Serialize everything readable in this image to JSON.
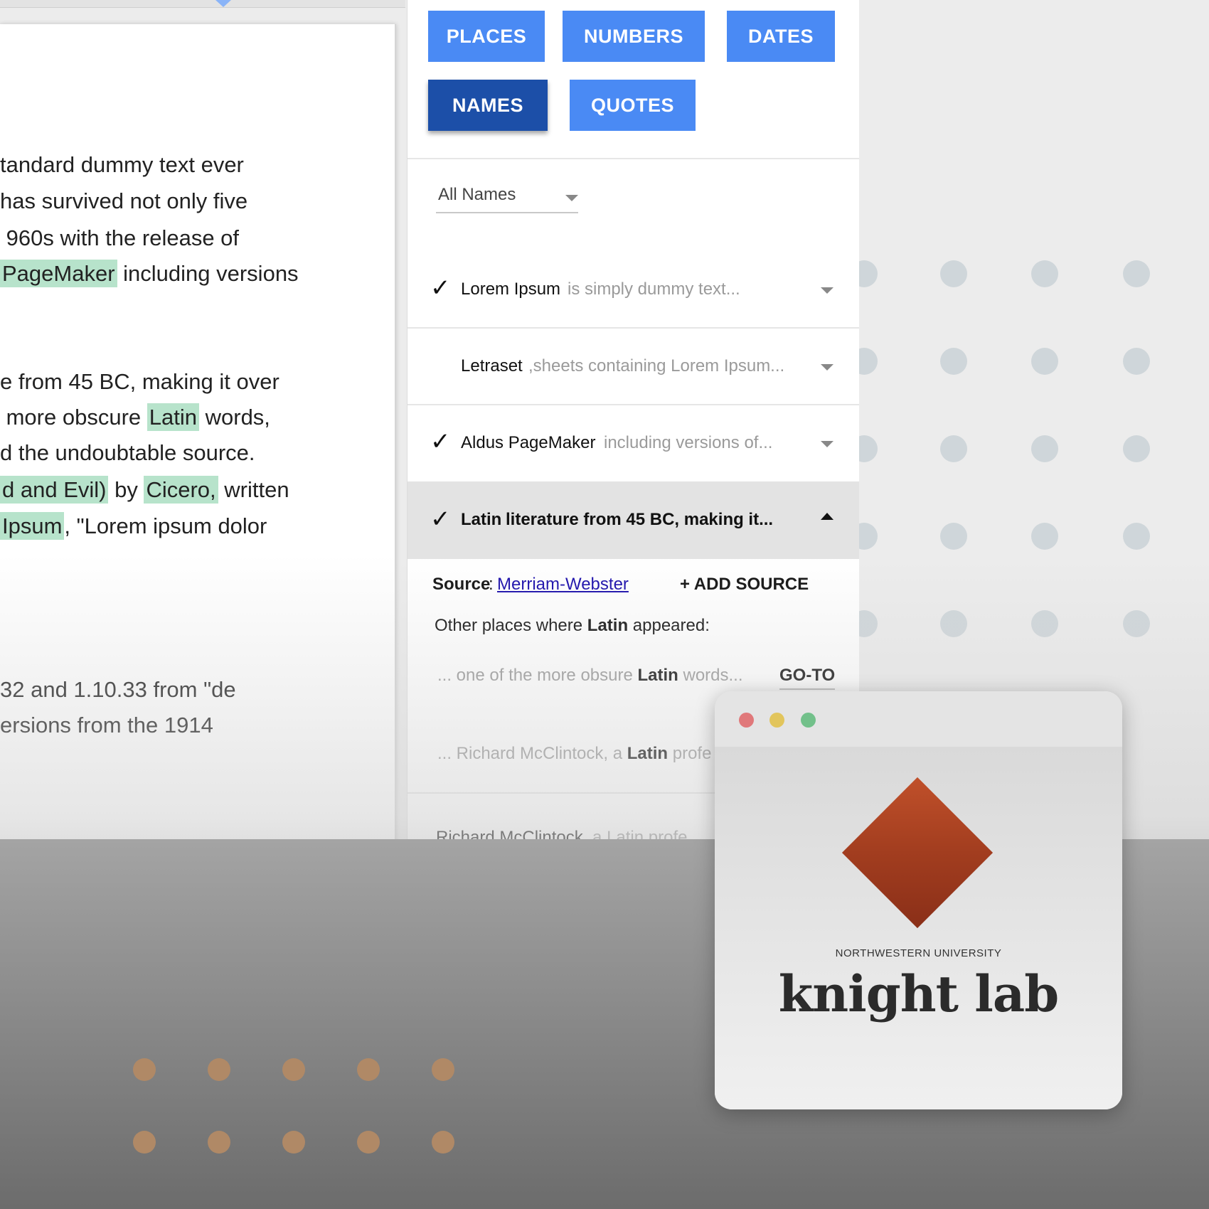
{
  "doc": {
    "lines": [
      {
        "t": "tandard dummy text ever"
      },
      {
        "t": "has survived not only five"
      },
      {
        "t": " 960s with the release of"
      },
      {
        "h": "PageMaker",
        "t": " including versions"
      },
      {
        "t": "e from 45 BC, making it over"
      },
      {
        "t": " more obscure ",
        "h": "Latin",
        "t2": " words,"
      },
      {
        "t": "d the undoubtable source."
      },
      {
        "h": "d and Evil)",
        "t": " by ",
        "h2": "Cicero,",
        "t2": " written"
      },
      {
        "h": "Ipsum",
        "t": ", \"Lorem ipsum dolor"
      },
      {
        "t": "32 and 1.10.33 from \"de"
      },
      {
        "t": "ersions from the 1914"
      }
    ]
  },
  "categories": [
    "PLACES",
    "NUMBERS",
    "DATES",
    "NAMES",
    "QUOTES"
  ],
  "active_category": "NAMES",
  "filter": {
    "label": "All Names"
  },
  "entries": [
    {
      "checked": true,
      "name": "Lorem Ipsum",
      "snippet": "is simply dummy text...",
      "open": false
    },
    {
      "checked": false,
      "name": "Letraset",
      "snippet": ",sheets containing Lorem Ipsum...",
      "open": false
    },
    {
      "checked": true,
      "name": "Aldus PageMaker",
      "snippet": "including versions of...",
      "open": false
    },
    {
      "checked": true,
      "name": "Latin",
      "snippet": "literature from 45 BC, making it...",
      "open": true
    }
  ],
  "detail": {
    "source_label": "Source",
    "source_link": "Merriam-Webster",
    "add_source": "+ ADD SOURCE",
    "other_places_prefix": "Other places where ",
    "other_places_term": "Latin",
    "other_places_suffix": " appeared:",
    "occurrences": [
      {
        "pre": "... one of the more obsure ",
        "term": "Latin",
        "post": " words..."
      },
      {
        "pre": "... Richard McClintock, a ",
        "term": "Latin",
        "post": " profe"
      }
    ],
    "goto": "GO-TO",
    "next_entry": {
      "name": "Richard McClintock",
      "snippet": ", a Latin profe"
    }
  },
  "logo": {
    "university": "NORTHWESTERN UNIVERSITY",
    "name": "knight lab"
  },
  "colors": {
    "button": "#4a8af4",
    "button_active": "#1c4fa8",
    "highlight": "#b7e3cb",
    "logo_orange": "#b3462a",
    "traffic_red": "#e0787a",
    "traffic_yellow": "#e2c55c",
    "traffic_green": "#72c08a"
  }
}
